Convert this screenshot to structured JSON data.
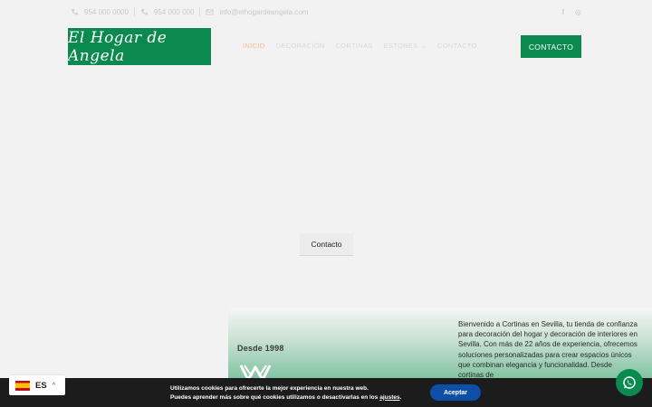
{
  "topbar": {
    "phone1": "954 000 0000",
    "phone2": "954 000 000",
    "email": "info@elhogardeangela.com"
  },
  "header": {
    "logo_text": "El Hogar de Angela",
    "nav": [
      {
        "label": "INICIO",
        "active": true
      },
      {
        "label": "DECORACIÓN",
        "active": false
      },
      {
        "label": "CORTINAS",
        "active": false
      },
      {
        "label": "ESTORES",
        "active": false,
        "has_dropdown": true
      },
      {
        "label": "CONTACTO",
        "active": false
      }
    ],
    "cta_label": "CONTACTO"
  },
  "hero": {
    "contact_button": "Contacto"
  },
  "about": {
    "since": "Desde 1998",
    "text": "Bienvenido a Cortinas en Sevilla, tu tienda de confianza para decoración del hogar y decoración de interiores en Sevilla. Con más de 22 años de experiencia, ofrecemos soluciones personalizadas para crear espacios únicos que combinan elegancia y funcionalidad. Desde cortinas de"
  },
  "cookie": {
    "line1": "Utilizamos cookies para ofrecerte la mejor experiencia en nuestra web.",
    "line2_prefix": "Puedes aprender más sobre qué cookies utilizamos o desactivarlas en los ",
    "line2_link": "ajustes",
    "line2_suffix": ".",
    "accept_label": "Aceptar"
  },
  "language": {
    "code": "ES"
  },
  "colors": {
    "brand_green": "#0b8a4f",
    "accept_blue": "#0d4fa8",
    "cookie_bg": "#1c1c1c"
  },
  "icons": [
    "phone-icon",
    "envelope-icon",
    "facebook-icon",
    "instagram-icon",
    "chevron-down-icon",
    "whatsapp-icon",
    "spain-flag-icon",
    "chevron-up-icon"
  ]
}
